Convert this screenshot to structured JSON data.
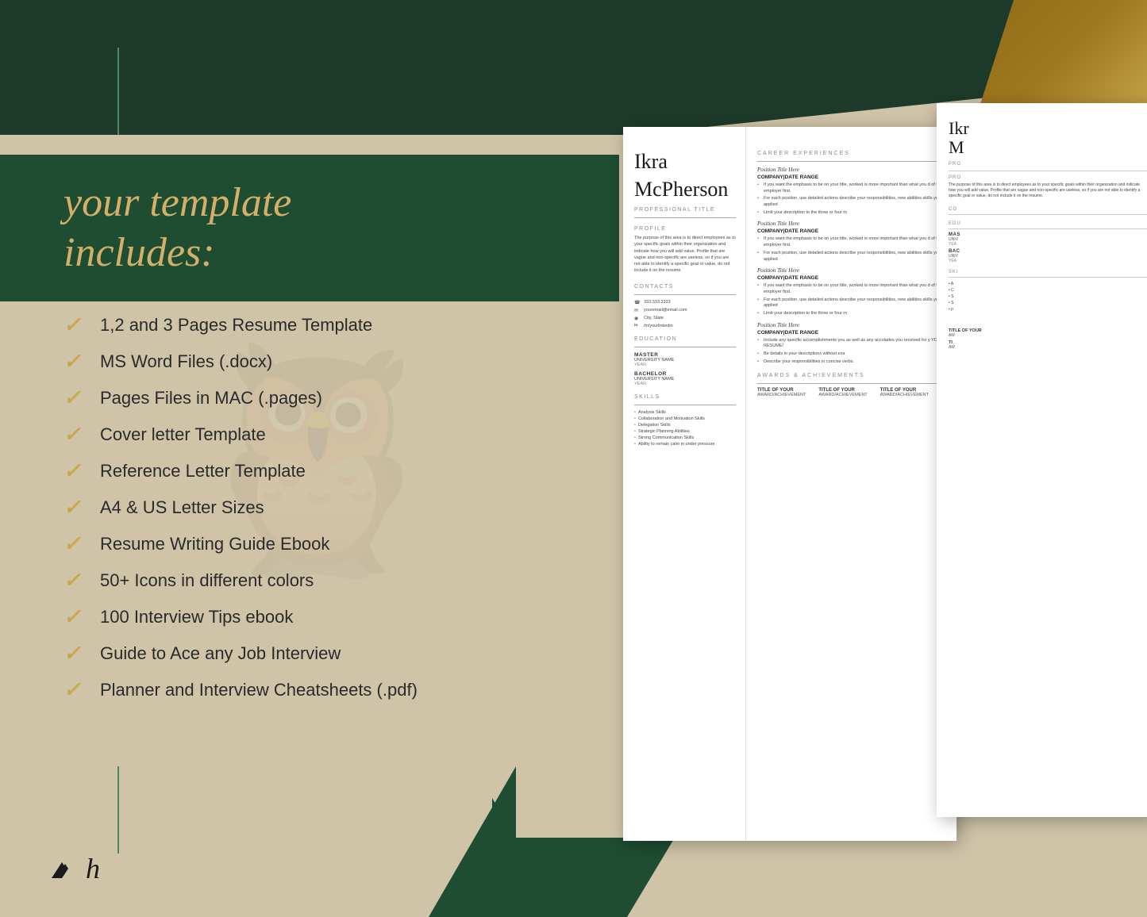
{
  "background": {
    "color": "#cfc4a8"
  },
  "banner": {
    "text_line1": "your template",
    "text_line2": "includes:"
  },
  "features": [
    {
      "check": "✓",
      "text": "1,2 and 3 Pages Resume Template"
    },
    {
      "check": "✓",
      "text": "MS Word Files (.docx)"
    },
    {
      "check": "✓",
      "text": "Pages Files in MAC (.pages)"
    },
    {
      "check": "✓",
      "text": "Cover letter Template"
    },
    {
      "check": "✓",
      "text": "Reference Letter Template"
    },
    {
      "check": "✓",
      "text": "A4 & US Letter Sizes"
    },
    {
      "check": "✓",
      "text": "Resume Writing Guide Ebook"
    },
    {
      "check": "✓",
      "text": "50+ Icons in different colors"
    },
    {
      "check": "✓",
      "text": "100 Interview Tips ebook"
    },
    {
      "check": "✓",
      "text": "Guide to Ace any Job Interview"
    },
    {
      "check": "✓",
      "text": "Planner and Interview Cheatsheets (.pdf)"
    }
  ],
  "logo": {
    "symbol": "⟩h",
    "brand": "h"
  },
  "resume": {
    "first_name": "Ikra",
    "last_name": "McPherson",
    "professional_title": "PROFESSIONAL TITLE",
    "profile_section": "PROFILE",
    "profile_text": "The purpose of this area is to direct employees as to your specific goals within their organization and indicate how you will add value. Profile that are vague and non-specific are useless, so if you are not able to identify a specific goal or value, do not include it on the resume.",
    "contacts_section": "CONTACTS",
    "contacts": [
      {
        "icon": "☎",
        "text": "333.333.3333"
      },
      {
        "icon": "✉",
        "text": "youremail@email.com"
      },
      {
        "icon": "⊙",
        "text": "City, State"
      },
      {
        "icon": "in",
        "text": "/in/yourlinkedin"
      }
    ],
    "education_section": "EDUCATION",
    "education": [
      {
        "degree": "MASTER",
        "school": "UNIVERSITY NAME",
        "year": "YEAR"
      },
      {
        "degree": "BACHELOR",
        "school": "UNIVERSITY NAME",
        "year": "YEAR"
      }
    ],
    "skills_section": "SKILLS",
    "skills": [
      "Analysis Skills",
      "Collaboration and Motivation Skills",
      "Delegation Skills",
      "Strategic Planning Abilities",
      "Strong Communication Skills",
      "Ability to remain calm in under pressure"
    ],
    "career_section": "CAREER EXPERIENCES",
    "positions": [
      {
        "title": "Position Title Here",
        "company": "COMPANY|DATE RANGE",
        "bullets": [
          "If you want the emphasis to be on your title, worked is more important than what you did of the employer first.",
          "For each position, use detailed actions describe your responsibilities, new abilities skills you applied",
          "Limit your description to the three or four m"
        ]
      },
      {
        "title": "Position Title Here",
        "company": "COMPANY|DATE RANGE",
        "bullets": [
          "If you want the emphasis to be on your title, worked is more important than what you did of the employer first.",
          "For each position, use detailed actions describe your responsibilities, new abilities skills you applied"
        ]
      },
      {
        "title": "Position Title Here",
        "company": "COMPANY|DATE RANGE",
        "bullets": [
          "If you want the emphasis to be on your title, worked is more important than what you did of the employer first.",
          "For each position, use detailed actions describe your responsibilities, new abilities skills you applied",
          "Limit your description to the three or four m"
        ]
      },
      {
        "title": "Position Title Here",
        "company": "COMPANY|DATE RANGE",
        "bullets": [
          "Include any specific accomplishments you as well as any accolades you received for y YOUR RESUME!",
          "Be details in your descriptions without exa",
          "Describe your responsibilities in concise verbs."
        ]
      }
    ],
    "awards_section": "AWARDS & ACHIEVEMENTS",
    "awards": [
      {
        "title": "TITLE OF YOUR",
        "sub": "AWARD/ACHIEVEMENT"
      },
      {
        "title": "TITLE OF YOUR",
        "sub": "AWARD/ACHIEVEMENT"
      },
      {
        "title": "TITLE OF YOUR",
        "sub": "AWARD/ACHIEVEMENT"
      }
    ],
    "skills_right": "SK|",
    "skills_right_items": [
      "A",
      "C",
      "S",
      "S",
      "p"
    ]
  },
  "resume2": {
    "name_partial": "Ikr",
    "last_name_partial": "M",
    "pro_label": "PRO",
    "section1": "PRO",
    "section2": "The",
    "contacts_label": "CO",
    "education_label": "EDU",
    "mas": "MAS",
    "uni": "UNIV",
    "year": "YEA",
    "bac": "BAC",
    "uni2": "UNIV",
    "year2": "YEA",
    "skills_label": "SKI",
    "awards_title": "TITLE OF YOUR",
    "awards_sub": "AW"
  },
  "colors": {
    "dark_green": "#1e4d32",
    "medium_green": "#2d5c3e",
    "gold": "#c9a84c",
    "dark_gold": "#8b6914",
    "bg_tan": "#cfc4a8",
    "text_dark": "#2a2a2a"
  }
}
